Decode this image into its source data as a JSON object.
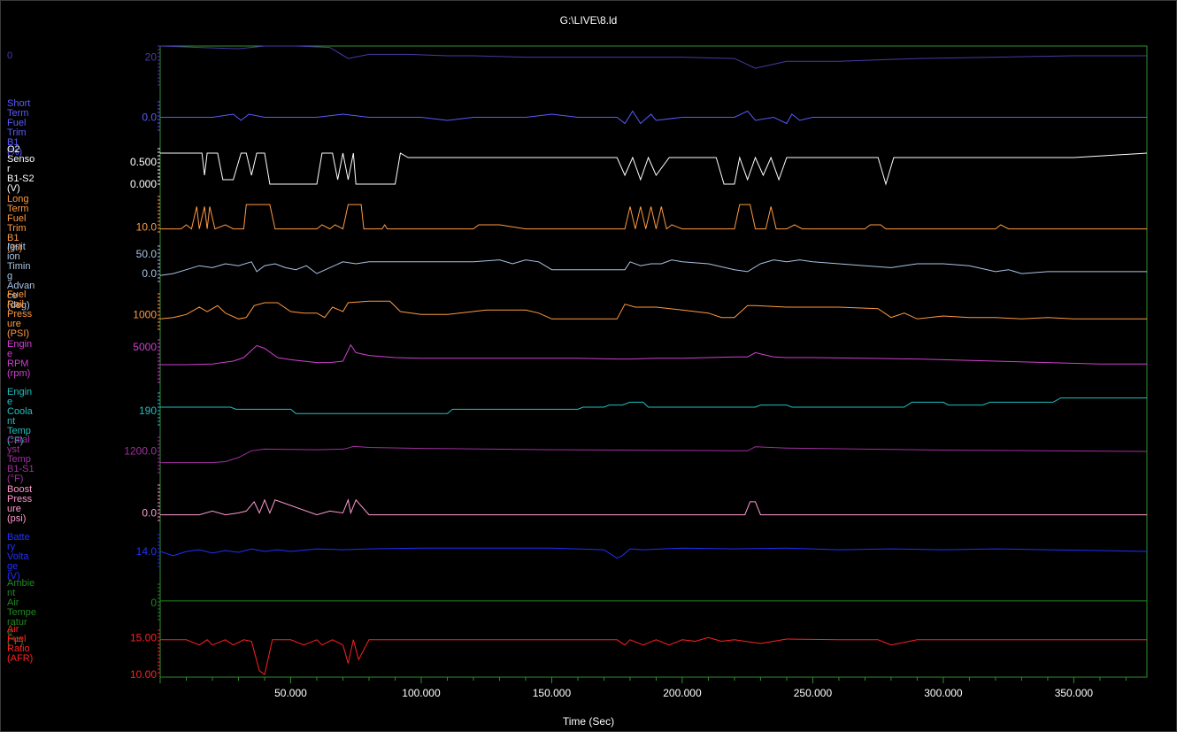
{
  "window": {
    "title": "G:\\LIVE\\8.ld"
  },
  "chart_data": {
    "type": "line",
    "title": "G:\\LIVE\\8.ld",
    "xlabel": "Time (Sec)",
    "x_ticks": [
      "50.000",
      "100.000",
      "150.000",
      "200.000",
      "250.000",
      "300.000",
      "350.000"
    ],
    "x_tick_values": [
      50,
      100,
      150,
      200,
      250,
      300,
      350
    ],
    "xlim": [
      0,
      378
    ],
    "grid": false,
    "channels": [
      {
        "name": "0",
        "color": "#4a3aa8",
        "tick_labels": [
          "20"
        ],
        "tick_values": [
          20
        ],
        "ylim": [
          0,
          28
        ],
        "x": [
          0,
          15,
          30,
          40,
          52,
          65,
          72,
          80,
          95,
          110,
          120,
          140,
          165,
          180,
          200,
          220,
          228,
          240,
          260,
          290,
          320,
          350,
          378
        ],
        "y": [
          28,
          27,
          26,
          28,
          28,
          27,
          19,
          22,
          22,
          21,
          21,
          20,
          20,
          20,
          20,
          19,
          12,
          17,
          17,
          19,
          20,
          21,
          21
        ]
      },
      {
        "name": "Short Term Fuel Trim B1 (%)",
        "color": "#5a5aff",
        "tick_labels": [
          "0.0"
        ],
        "tick_values": [
          0
        ],
        "ylim": [
          -5,
          5
        ],
        "x": [
          0,
          20,
          28,
          31,
          34,
          40,
          50,
          60,
          70,
          80,
          90,
          100,
          110,
          120,
          140,
          150,
          160,
          175,
          178,
          181,
          184,
          188,
          190,
          200,
          210,
          220,
          225,
          228,
          235,
          240,
          242,
          245,
          250,
          260,
          280,
          300,
          320,
          340,
          360,
          378
        ],
        "y": [
          0,
          0,
          1,
          -1,
          1,
          0,
          0,
          0,
          1,
          0,
          0,
          0,
          -1,
          0,
          0,
          1,
          0,
          0,
          -2,
          2,
          -2,
          1,
          -1,
          0,
          0,
          0,
          2,
          -1,
          0,
          -2,
          1,
          -1,
          0,
          0,
          0,
          0,
          0,
          0,
          0,
          0
        ]
      },
      {
        "name": "O2 Sensor B1-S2 (V)",
        "color": "#ffffff",
        "tick_labels": [
          "0.500",
          "0.000"
        ],
        "tick_values": [
          0.5,
          0
        ],
        "ylim": [
          0,
          0.8
        ],
        "x": [
          0,
          10,
          16,
          17,
          18,
          22,
          24,
          25,
          28,
          31,
          33,
          35,
          37,
          40,
          42,
          44,
          60,
          62,
          66,
          68,
          70,
          72,
          74,
          75,
          80,
          90,
          92,
          95,
          120,
          140,
          150,
          175,
          178,
          181,
          184,
          187,
          190,
          195,
          200,
          213,
          216,
          220,
          222,
          225,
          228,
          231,
          234,
          237,
          240,
          242,
          250,
          275,
          278,
          281,
          284,
          290,
          320,
          350,
          378
        ],
        "y": [
          0.7,
          0.7,
          0.7,
          0.2,
          0.7,
          0.7,
          0.1,
          0.1,
          0.1,
          0.7,
          0.7,
          0.2,
          0.7,
          0.7,
          0.0,
          0.0,
          0.0,
          0.7,
          0.7,
          0.1,
          0.7,
          0.1,
          0.7,
          0.0,
          0.0,
          0.0,
          0.7,
          0.6,
          0.6,
          0.6,
          0.6,
          0.6,
          0.2,
          0.6,
          0.1,
          0.6,
          0.2,
          0.6,
          0.6,
          0.6,
          0.0,
          0.0,
          0.6,
          0.1,
          0.6,
          0.2,
          0.6,
          0.1,
          0.6,
          0.6,
          0.6,
          0.6,
          0.0,
          0.6,
          0.6,
          0.6,
          0.6,
          0.6,
          0.7
        ]
      },
      {
        "name": "Long Term Fuel Trim B1 (%)",
        "color": "#ff9a40",
        "tick_labels": [
          "10.0"
        ],
        "tick_values": [
          10
        ],
        "ylim": [
          5,
          40
        ],
        "x": [
          0,
          8,
          10,
          12,
          14,
          15,
          17,
          18,
          19,
          21,
          25,
          28,
          32,
          33,
          42,
          44,
          52,
          60,
          62,
          65,
          67,
          70,
          72,
          74,
          77,
          78,
          80,
          85,
          86,
          87,
          100,
          120,
          122,
          130,
          140,
          178,
          180,
          182,
          184,
          186,
          188,
          190,
          192,
          194,
          196,
          200,
          215,
          220,
          222,
          225,
          226,
          228,
          232,
          234,
          236,
          240,
          243,
          246,
          270,
          272,
          276,
          278,
          300,
          320,
          322,
          325,
          340,
          378
        ],
        "y": [
          8,
          8,
          12,
          8,
          30,
          8,
          30,
          8,
          30,
          8,
          12,
          8,
          8,
          32,
          32,
          8,
          8,
          8,
          12,
          8,
          12,
          8,
          32,
          32,
          32,
          8,
          8,
          8,
          12,
          8,
          8,
          8,
          12,
          12,
          8,
          8,
          30,
          8,
          30,
          8,
          30,
          8,
          30,
          8,
          12,
          8,
          8,
          8,
          32,
          32,
          32,
          8,
          8,
          30,
          8,
          8,
          12,
          8,
          8,
          12,
          12,
          8,
          8,
          8,
          12,
          8,
          8,
          8
        ]
      },
      {
        "name": "Ignition Timing Advance (deg)",
        "color": "#a9c4e4",
        "tick_labels": [
          "50.0",
          "0.0"
        ],
        "tick_values": [
          50,
          0
        ],
        "ylim": [
          -20,
          70
        ],
        "x": [
          0,
          5,
          10,
          15,
          20,
          25,
          30,
          35,
          37,
          40,
          44,
          48,
          52,
          56,
          60,
          65,
          70,
          75,
          80,
          90,
          100,
          120,
          130,
          135,
          140,
          145,
          150,
          155,
          160,
          170,
          178,
          180,
          184,
          188,
          192,
          196,
          200,
          210,
          220,
          225,
          230,
          235,
          240,
          245,
          250,
          260,
          270,
          280,
          290,
          300,
          310,
          320,
          325,
          330,
          340,
          350,
          360,
          378
        ],
        "y": [
          -5,
          0,
          10,
          20,
          15,
          25,
          20,
          30,
          5,
          20,
          25,
          15,
          10,
          20,
          0,
          15,
          30,
          25,
          30,
          30,
          30,
          30,
          35,
          25,
          35,
          30,
          10,
          10,
          10,
          10,
          10,
          30,
          20,
          25,
          25,
          35,
          30,
          25,
          10,
          5,
          25,
          35,
          30,
          35,
          30,
          25,
          20,
          15,
          25,
          25,
          20,
          5,
          10,
          0,
          5,
          5,
          5,
          5
        ]
      },
      {
        "name": "Fuel Rail Pressure (PSI)",
        "color": "#ff9a40",
        "tick_labels": [
          "1000"
        ],
        "tick_values": [
          1000
        ],
        "ylim": [
          500,
          1700
        ],
        "x": [
          0,
          5,
          10,
          15,
          18,
          22,
          25,
          30,
          33,
          36,
          40,
          45,
          50,
          55,
          60,
          63,
          66,
          70,
          72,
          80,
          88,
          92,
          100,
          110,
          125,
          140,
          145,
          150,
          160,
          170,
          175,
          178,
          182,
          190,
          200,
          210,
          215,
          220,
          225,
          228,
          240,
          260,
          275,
          280,
          285,
          290,
          300,
          310,
          320,
          330,
          340,
          350,
          378
        ],
        "y": [
          850,
          900,
          1000,
          1250,
          1100,
          1300,
          1050,
          850,
          900,
          1300,
          1400,
          1400,
          1100,
          1050,
          1050,
          900,
          1250,
          1100,
          1400,
          1450,
          1450,
          1100,
          1000,
          1000,
          1150,
          1150,
          1050,
          850,
          850,
          850,
          850,
          1350,
          1250,
          1250,
          1150,
          1050,
          900,
          900,
          1300,
          1300,
          1250,
          1250,
          1200,
          900,
          1050,
          850,
          950,
          900,
          900,
          850,
          900,
          850,
          850
        ]
      },
      {
        "name": "Engine RPM (rpm)",
        "color": "#d040d0",
        "tick_labels": [
          "5000"
        ],
        "tick_values": [
          5000
        ],
        "ylim": [
          0,
          6000
        ],
        "x": [
          0,
          10,
          20,
          28,
          32,
          37,
          40,
          45,
          50,
          55,
          60,
          65,
          70,
          73,
          75,
          80,
          90,
          100,
          130,
          160,
          175,
          180,
          190,
          200,
          220,
          225,
          228,
          235,
          240,
          250,
          270,
          290,
          300,
          320,
          340,
          360,
          378
        ],
        "y": [
          2500,
          2500,
          2600,
          3000,
          3500,
          5200,
          4800,
          3500,
          3200,
          3000,
          2800,
          2800,
          3000,
          5300,
          4200,
          3800,
          3500,
          3400,
          3400,
          3400,
          3300,
          3300,
          3400,
          3400,
          3600,
          3600,
          4200,
          3600,
          3500,
          3500,
          3400,
          3300,
          3200,
          3000,
          2800,
          2600,
          2600
        ]
      },
      {
        "name": "Engine Coolant Temp (°F)",
        "color": "#20c0c0",
        "tick_labels": [
          "190"
        ],
        "tick_values": [
          190
        ],
        "ylim": [
          170,
          215
        ],
        "x": [
          0,
          27,
          29,
          50,
          52,
          110,
          112,
          160,
          162,
          170,
          172,
          177,
          180,
          185,
          187,
          228,
          230,
          240,
          242,
          285,
          288,
          300,
          302,
          315,
          318,
          342,
          345,
          378
        ],
        "y": [
          195,
          195,
          192,
          192,
          186,
          186,
          192,
          192,
          195,
          195,
          198,
          198,
          202,
          202,
          195,
          195,
          198,
          198,
          195,
          195,
          202,
          202,
          198,
          198,
          202,
          202,
          208,
          208
        ]
      },
      {
        "name": "Catalyst Temp B1-S1 (°F)",
        "color": "#a030a0",
        "tick_labels": [
          "1200.0"
        ],
        "tick_values": [
          1200
        ],
        "ylim": [
          500,
          1600
        ],
        "x": [
          0,
          10,
          20,
          25,
          30,
          35,
          40,
          60,
          70,
          72,
          74,
          80,
          100,
          150,
          200,
          220,
          225,
          228,
          240,
          300,
          378
        ],
        "y": [
          850,
          850,
          850,
          880,
          1000,
          1200,
          1250,
          1230,
          1250,
          1280,
          1330,
          1300,
          1270,
          1230,
          1210,
          1200,
          1200,
          1320,
          1280,
          1220,
          1180
        ]
      },
      {
        "name": "Boost Pressure (psi)",
        "color": "#ff9ad0",
        "tick_labels": [
          "0.0"
        ],
        "tick_values": [
          0
        ],
        "ylim": [
          -5,
          15
        ],
        "x": [
          0,
          15,
          20,
          25,
          30,
          33,
          36,
          38,
          40,
          42,
          44,
          60,
          65,
          70,
          72,
          73,
          75,
          80,
          100,
          150,
          200,
          224,
          226,
          228,
          230,
          250,
          300,
          378
        ],
        "y": [
          -1,
          -1,
          1,
          -1,
          0,
          1,
          6,
          0,
          7,
          0,
          7,
          -1,
          1,
          0,
          7,
          0,
          7,
          -1,
          -1,
          -1,
          -1,
          -1,
          6,
          6,
          -1,
          -1,
          -1,
          -1
        ]
      },
      {
        "name": "Battery Voltage (V)",
        "color": "#2030ff",
        "tick_labels": [
          "14.0"
        ],
        "tick_values": [
          14
        ],
        "ylim": [
          12,
          16
        ],
        "x": [
          0,
          5,
          10,
          15,
          20,
          25,
          30,
          35,
          40,
          45,
          50,
          60,
          70,
          80,
          100,
          120,
          150,
          170,
          175,
          177,
          180,
          185,
          200,
          220,
          240,
          260,
          280,
          300,
          320,
          340,
          360,
          378
        ],
        "y": [
          14.0,
          13.5,
          14.0,
          14.2,
          13.8,
          14.1,
          13.9,
          14.3,
          14.0,
          14.2,
          14.0,
          14.3,
          14.2,
          14.3,
          14.4,
          14.4,
          14.4,
          14.2,
          13.2,
          13.5,
          14.3,
          14.2,
          14.4,
          14.3,
          14.4,
          14.2,
          14.3,
          14.2,
          14.3,
          14.2,
          14.1,
          14.0
        ]
      },
      {
        "name": "Ambient Air Temperature (°F)",
        "color": "#208820",
        "tick_labels": [
          "0"
        ],
        "tick_values": [
          0
        ],
        "ylim": [
          -5,
          5
        ],
        "x": [
          0,
          378
        ],
        "y": [
          0.5,
          0.5
        ]
      },
      {
        "name": "Air Fuel Ratio (AFR)",
        "color": "#ff2020",
        "tick_labels": [
          "15.00",
          "10.00"
        ],
        "tick_values": [
          15,
          10
        ],
        "ylim": [
          10,
          16
        ],
        "x": [
          0,
          10,
          15,
          18,
          20,
          25,
          28,
          32,
          35,
          38,
          40,
          43,
          50,
          55,
          60,
          62,
          66,
          70,
          72,
          74,
          76,
          80,
          100,
          150,
          175,
          178,
          180,
          185,
          190,
          195,
          200,
          205,
          210,
          215,
          220,
          230,
          240,
          260,
          275,
          280,
          290,
          378
        ],
        "y": [
          14.7,
          14.7,
          14.0,
          14.7,
          14.0,
          14.7,
          14.0,
          14.7,
          14.5,
          10.5,
          10.0,
          14.7,
          14.7,
          14.0,
          14.7,
          14.0,
          14.7,
          14.0,
          11.5,
          14.7,
          12.0,
          14.7,
          14.7,
          14.7,
          14.7,
          14.0,
          14.7,
          14.0,
          14.7,
          14.0,
          14.7,
          14.5,
          15.0,
          14.5,
          14.7,
          14.2,
          14.8,
          14.7,
          14.7,
          14.0,
          14.7,
          14.7
        ]
      }
    ]
  }
}
